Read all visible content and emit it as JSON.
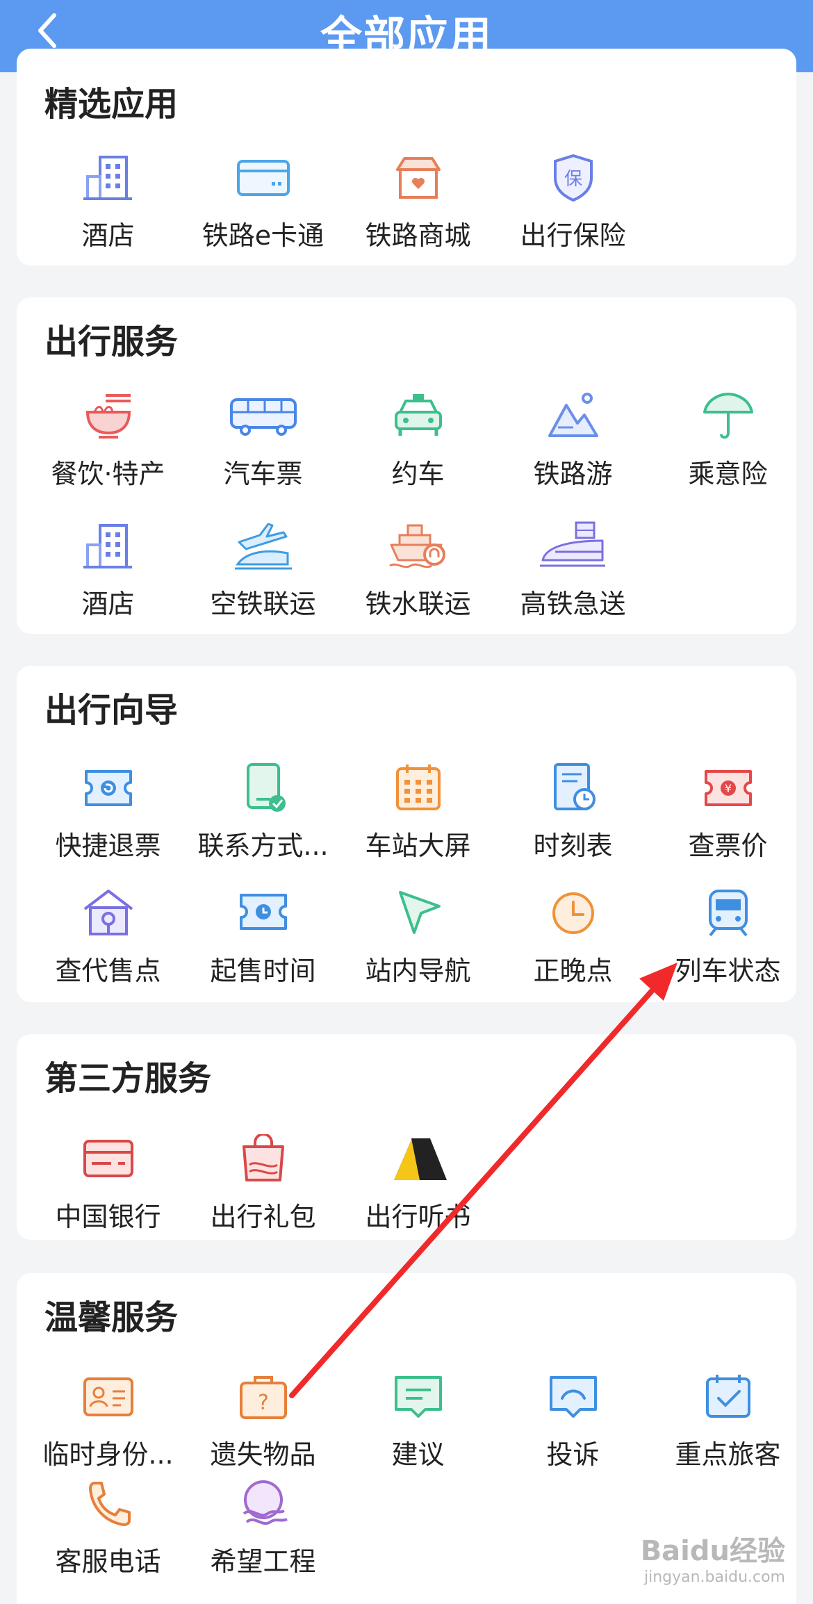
{
  "header": {
    "title": "全部应用"
  },
  "sections": [
    {
      "title": "精选应用",
      "items": [
        "酒店",
        "铁路e卡通",
        "铁路商城",
        "出行保险"
      ]
    },
    {
      "title": "出行服务",
      "items": [
        "餐饮·特产",
        "汽车票",
        "约车",
        "铁路游",
        "乘意险",
        "酒店",
        "空铁联运",
        "铁水联运",
        "高铁急送"
      ]
    },
    {
      "title": "出行向导",
      "items": [
        "快捷退票",
        "联系方式...",
        "车站大屏",
        "时刻表",
        "查票价",
        "查代售点",
        "起售时间",
        "站内导航",
        "正晚点",
        "列车状态"
      ]
    },
    {
      "title": "第三方服务",
      "items": [
        "中国银行",
        "出行礼包",
        "出行听书"
      ]
    },
    {
      "title": "温馨服务",
      "items": [
        "临时身份...",
        "遗失物品",
        "建议",
        "投诉",
        "重点旅客",
        "客服电话",
        "希望工程"
      ]
    }
  ],
  "watermark": {
    "main": "Baidu经验",
    "sub": "jingyan.baidu.com"
  }
}
